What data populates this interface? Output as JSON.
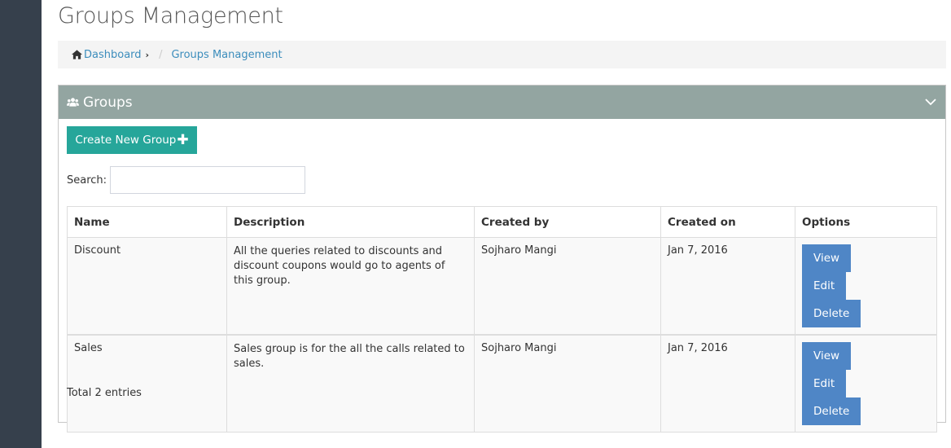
{
  "page": {
    "title": "Groups Management"
  },
  "breadcrumb": {
    "home_label": "Dashboard",
    "current_label": "Groups Management"
  },
  "panel": {
    "title": "Groups",
    "create_button_label": "Create New Group",
    "search_label": "Search:",
    "search_value": "",
    "total_text": "Total 2 entries"
  },
  "table": {
    "headers": [
      "Name",
      "Description",
      "Created by",
      "Created on",
      "Options"
    ],
    "rows": [
      {
        "name": "Discount",
        "description": "All the queries related to discounts and discount coupons would go to agents of this group.",
        "created_by": "Sojharo Mangi",
        "created_on": "Jan 7, 2016",
        "view": "View",
        "edit": "Edit",
        "delete": "Delete"
      },
      {
        "name": "Sales",
        "description": "Sales group is for the all the calls related to sales.",
        "created_by": "Sojharo Mangi",
        "created_on": "Jan 7, 2016",
        "view": "View",
        "edit": "Edit",
        "delete": "Delete"
      }
    ]
  },
  "colors": {
    "sidebar": "#36404c",
    "panel_header": "#93a5a1",
    "create_button": "#26a69a",
    "option_button": "#4f86c6",
    "link": "#3c8dbc"
  },
  "icons": {
    "breadcrumb_home": "home-icon",
    "breadcrumb_chevron": "chevron-right-icon",
    "panel": "users-icon",
    "collapse": "chevron-down-icon",
    "create": "plus-icon"
  }
}
